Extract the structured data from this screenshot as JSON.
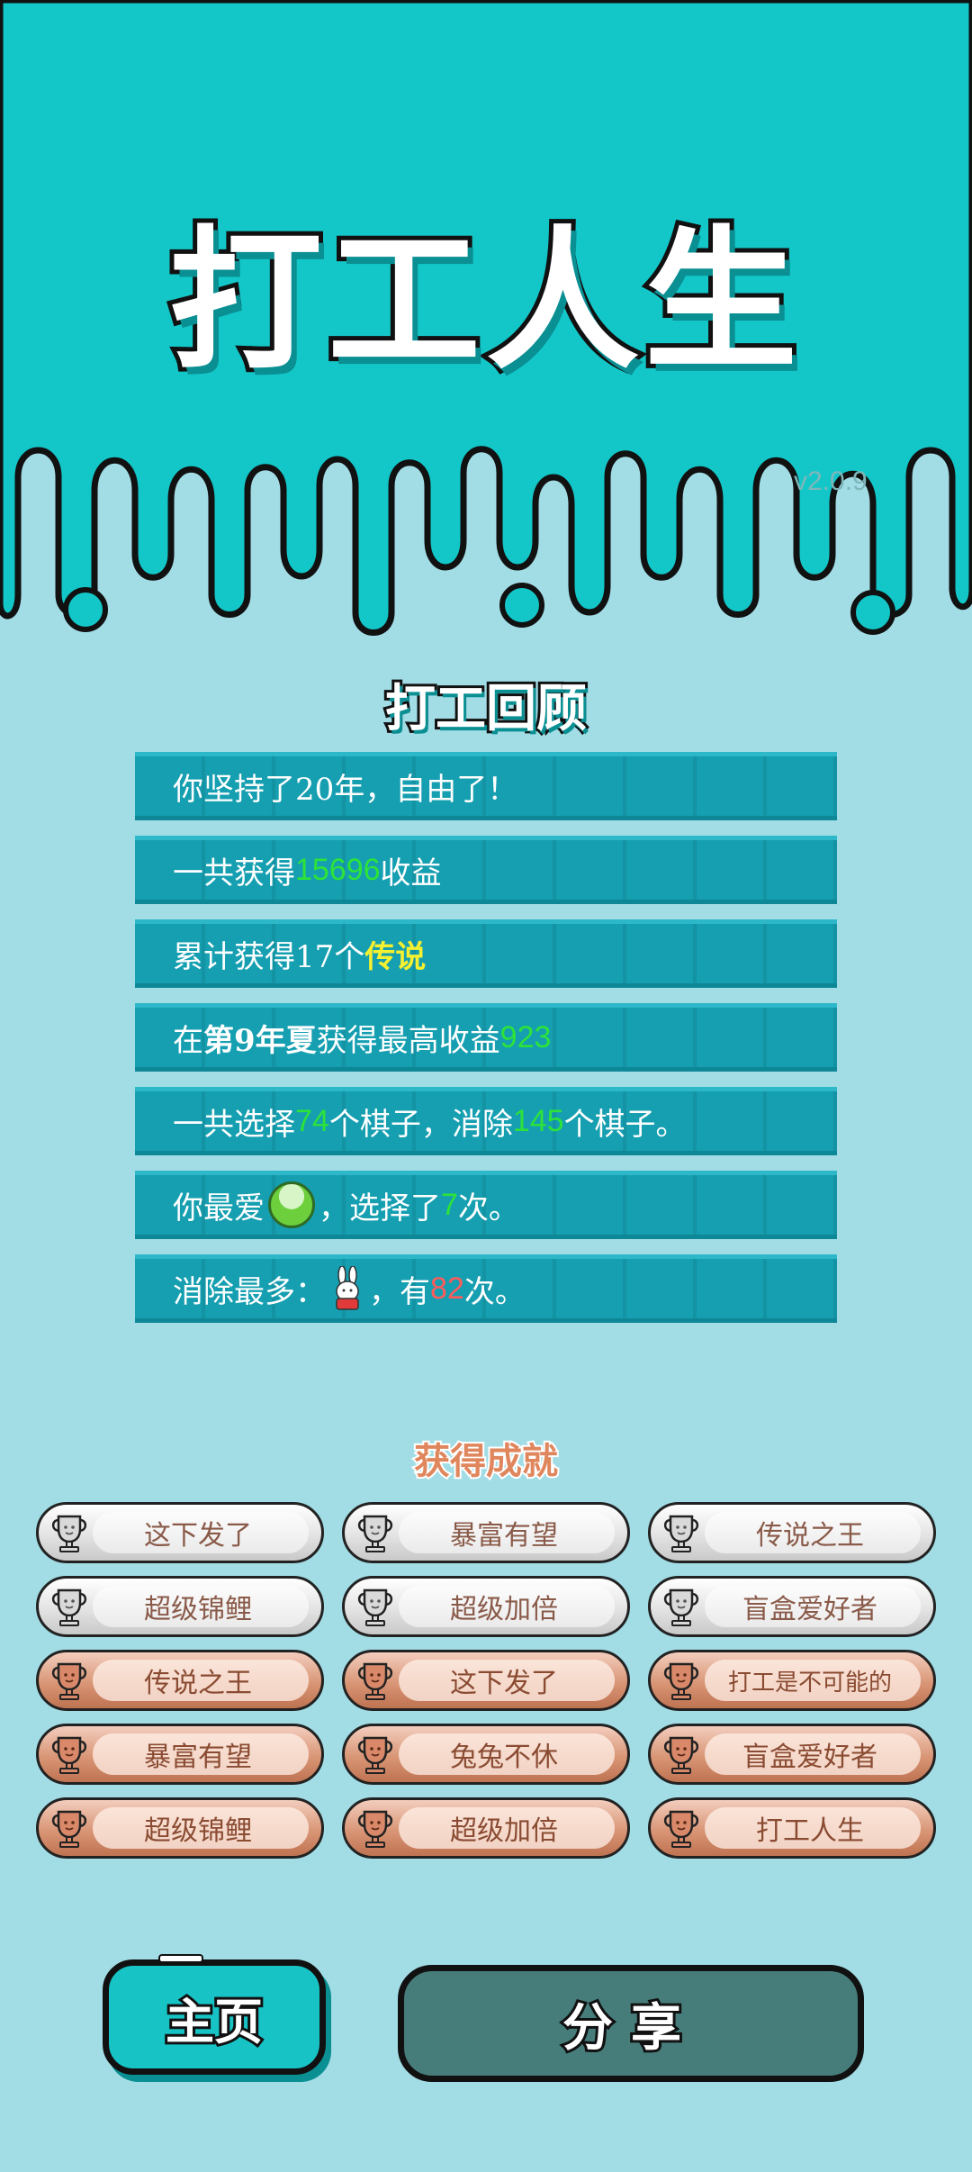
{
  "header": {
    "title": "打工人生",
    "version": "v2.0.9"
  },
  "review": {
    "title": "打工回顾",
    "stats": [
      {
        "parts": [
          {
            "t": "你坚持了20年，自由了！",
            "c": ""
          }
        ]
      },
      {
        "parts": [
          {
            "t": "一共获得",
            "c": ""
          },
          {
            "t": "15696",
            "c": "g"
          },
          {
            "t": "收益",
            "c": ""
          }
        ]
      },
      {
        "parts": [
          {
            "t": "累计获得17个",
            "c": ""
          },
          {
            "t": "传说",
            "c": "y"
          }
        ]
      },
      {
        "parts": [
          {
            "t": "在 ",
            "c": ""
          },
          {
            "t": "第9年夏",
            "c": "b"
          },
          {
            "t": " 获得最高收益",
            "c": ""
          },
          {
            "t": "923",
            "c": "g"
          }
        ]
      },
      {
        "parts": [
          {
            "t": "一共选择",
            "c": ""
          },
          {
            "t": "74",
            "c": "g"
          },
          {
            "t": "个棋子，消除",
            "c": ""
          },
          {
            "t": "145",
            "c": "g"
          },
          {
            "t": "个棋子。",
            "c": ""
          }
        ]
      },
      {
        "parts": [
          {
            "t": "你最爱",
            "c": ""
          },
          {
            "t": "",
            "c": "icon-ball"
          },
          {
            "t": "，选择了",
            "c": ""
          },
          {
            "t": "7",
            "c": "g"
          },
          {
            "t": "次。",
            "c": ""
          }
        ]
      },
      {
        "parts": [
          {
            "t": "消除最多：",
            "c": ""
          },
          {
            "t": "",
            "c": "icon-bunny"
          },
          {
            "t": "，有",
            "c": ""
          },
          {
            "t": "82",
            "c": "r"
          },
          {
            "t": "次。",
            "c": ""
          }
        ]
      }
    ]
  },
  "achievements": {
    "title": "获得成就",
    "items": [
      {
        "label": "这下发了",
        "tier": "silver"
      },
      {
        "label": "暴富有望",
        "tier": "silver"
      },
      {
        "label": "传说之王",
        "tier": "silver"
      },
      {
        "label": "超级锦鲤",
        "tier": "silver"
      },
      {
        "label": "超级加倍",
        "tier": "silver"
      },
      {
        "label": "盲盒爱好者",
        "tier": "silver"
      },
      {
        "label": "传说之王",
        "tier": "bronze"
      },
      {
        "label": "这下发了",
        "tier": "bronze"
      },
      {
        "label": "打工是不可能的",
        "tier": "bronze"
      },
      {
        "label": "暴富有望",
        "tier": "bronze"
      },
      {
        "label": "兔兔不休",
        "tier": "bronze"
      },
      {
        "label": "盲盒爱好者",
        "tier": "bronze"
      },
      {
        "label": "超级锦鲤",
        "tier": "bronze"
      },
      {
        "label": "超级加倍",
        "tier": "bronze"
      },
      {
        "label": "打工人生",
        "tier": "bronze"
      }
    ]
  },
  "buttons": {
    "home": "主页",
    "share": "分享"
  },
  "colors": {
    "top_bg": "#13c7c9",
    "page_bg": "#a2dde6",
    "stat_bg": "#159fb1",
    "highlight_green": "#2de33a",
    "highlight_yellow": "#f5f030",
    "highlight_red": "#ff5b5b"
  }
}
